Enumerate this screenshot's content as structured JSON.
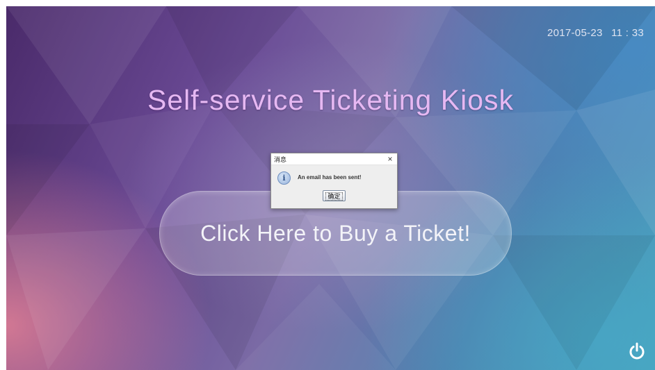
{
  "clock": {
    "date": "2017-05-23",
    "time": "11 : 33"
  },
  "title": "Self-service Ticketing Kiosk",
  "main_button": {
    "label": "Click Here to Buy a Ticket!"
  },
  "dialog": {
    "title": "消息",
    "close_glyph": "×",
    "icon": "info-icon",
    "icon_glyph": "i",
    "message": "An email has been sent!",
    "ok_label": "确定"
  },
  "power_button": {
    "icon": "power-icon"
  },
  "colors": {
    "title": "#e6b8f2",
    "power_icon": "#ffffff"
  }
}
